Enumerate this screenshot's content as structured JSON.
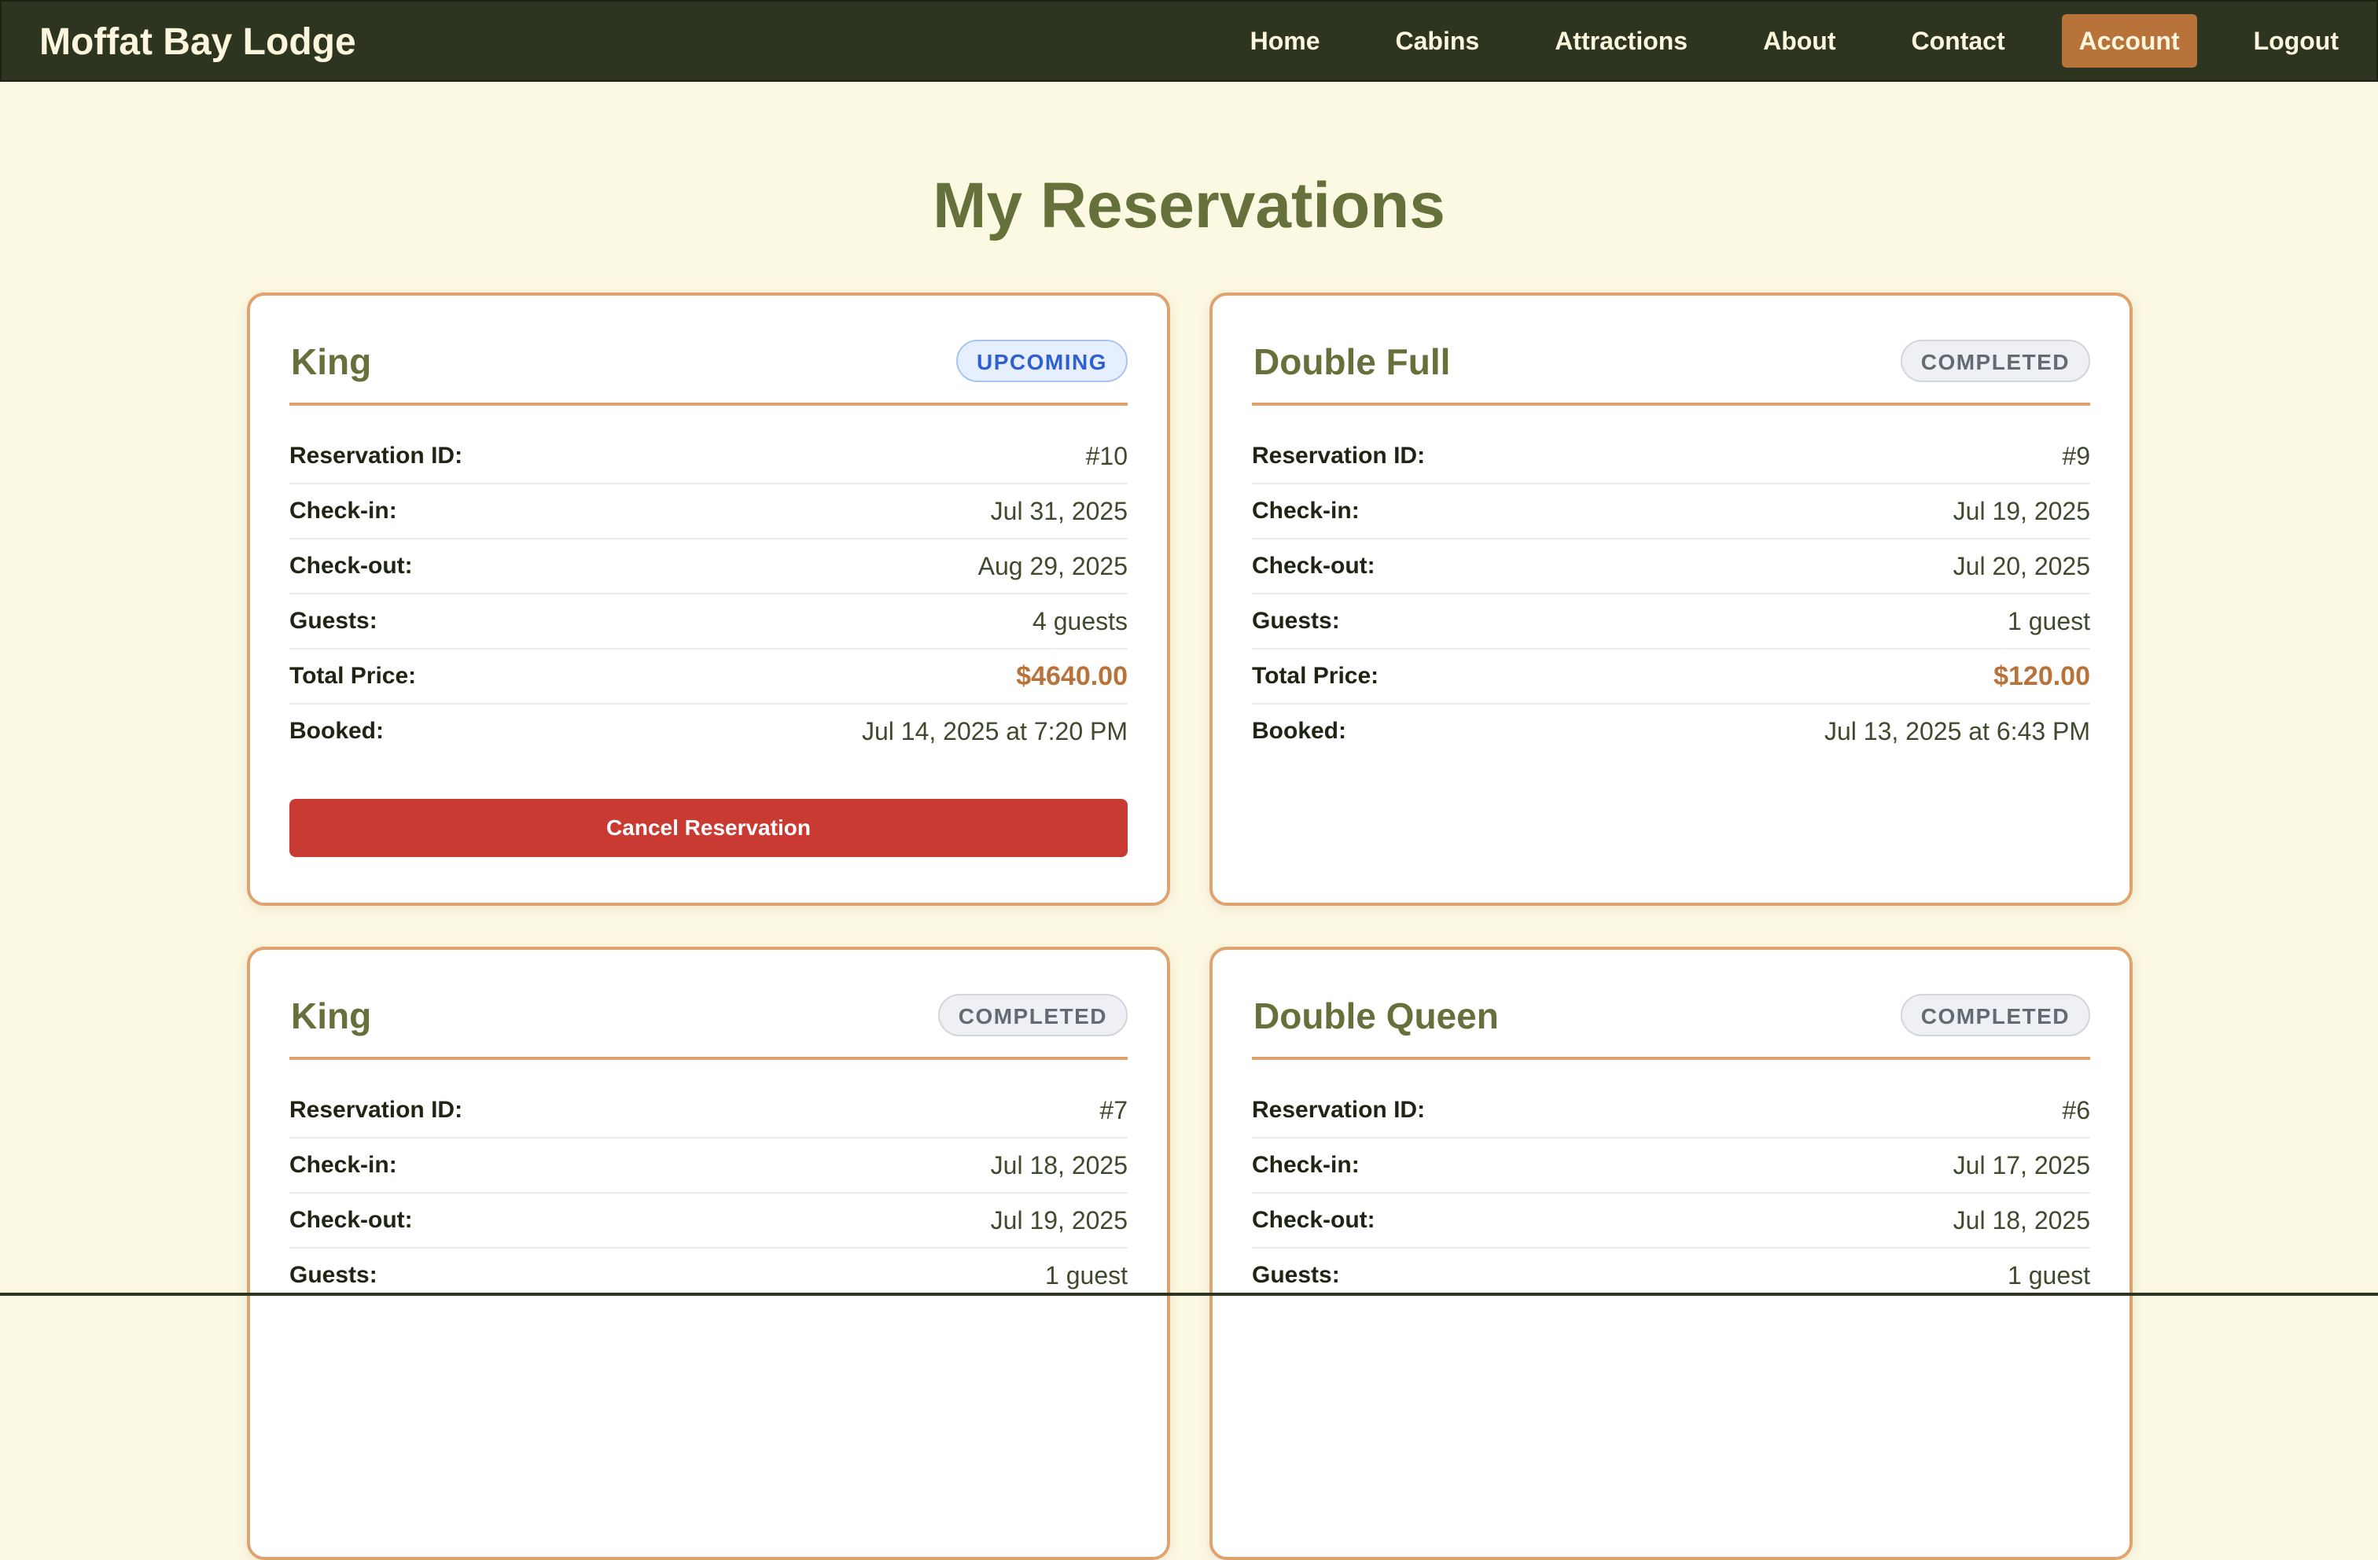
{
  "nav": {
    "brand": "Moffat Bay Lodge",
    "links": [
      "Home",
      "Cabins",
      "Attractions",
      "About",
      "Contact",
      "Account",
      "Logout"
    ],
    "active": "Account"
  },
  "page_title": "My Reservations",
  "labels": {
    "reservation_id": "Reservation ID:",
    "check_in": "Check-in:",
    "check_out": "Check-out:",
    "guests": "Guests:",
    "total_price": "Total Price:",
    "booked": "Booked:"
  },
  "colors": {
    "nav_bg": "#2d3520",
    "page_bg": "#fcf9e3",
    "accent": "#b8733b",
    "card_border": "#dfa36f",
    "title_green": "#66703b",
    "cancel_red": "#c93a33",
    "upcoming_blue": "#2f5fd0"
  },
  "reservations": [
    {
      "room": "King",
      "status": "UPCOMING",
      "reservation_id": "#10",
      "check_in": "Jul 31, 2025",
      "check_out": "Aug 29, 2025",
      "guests": "4 guests",
      "total_price": "$4640.00",
      "booked": "Jul 14, 2025 at 7:20 PM",
      "cancel_label": "Cancel Reservation"
    },
    {
      "room": "Double Full",
      "status": "COMPLETED",
      "reservation_id": "#9",
      "check_in": "Jul 19, 2025",
      "check_out": "Jul 20, 2025",
      "guests": "1 guest",
      "total_price": "$120.00",
      "booked": "Jul 13, 2025 at 6:43 PM"
    },
    {
      "room": "King",
      "status": "COMPLETED",
      "reservation_id": "#7",
      "check_in": "Jul 18, 2025",
      "check_out": "Jul 19, 2025",
      "guests": "1 guest"
    },
    {
      "room": "Double Queen",
      "status": "COMPLETED",
      "reservation_id": "#6",
      "check_in": "Jul 17, 2025",
      "check_out": "Jul 18, 2025",
      "guests": "1 guest"
    }
  ]
}
